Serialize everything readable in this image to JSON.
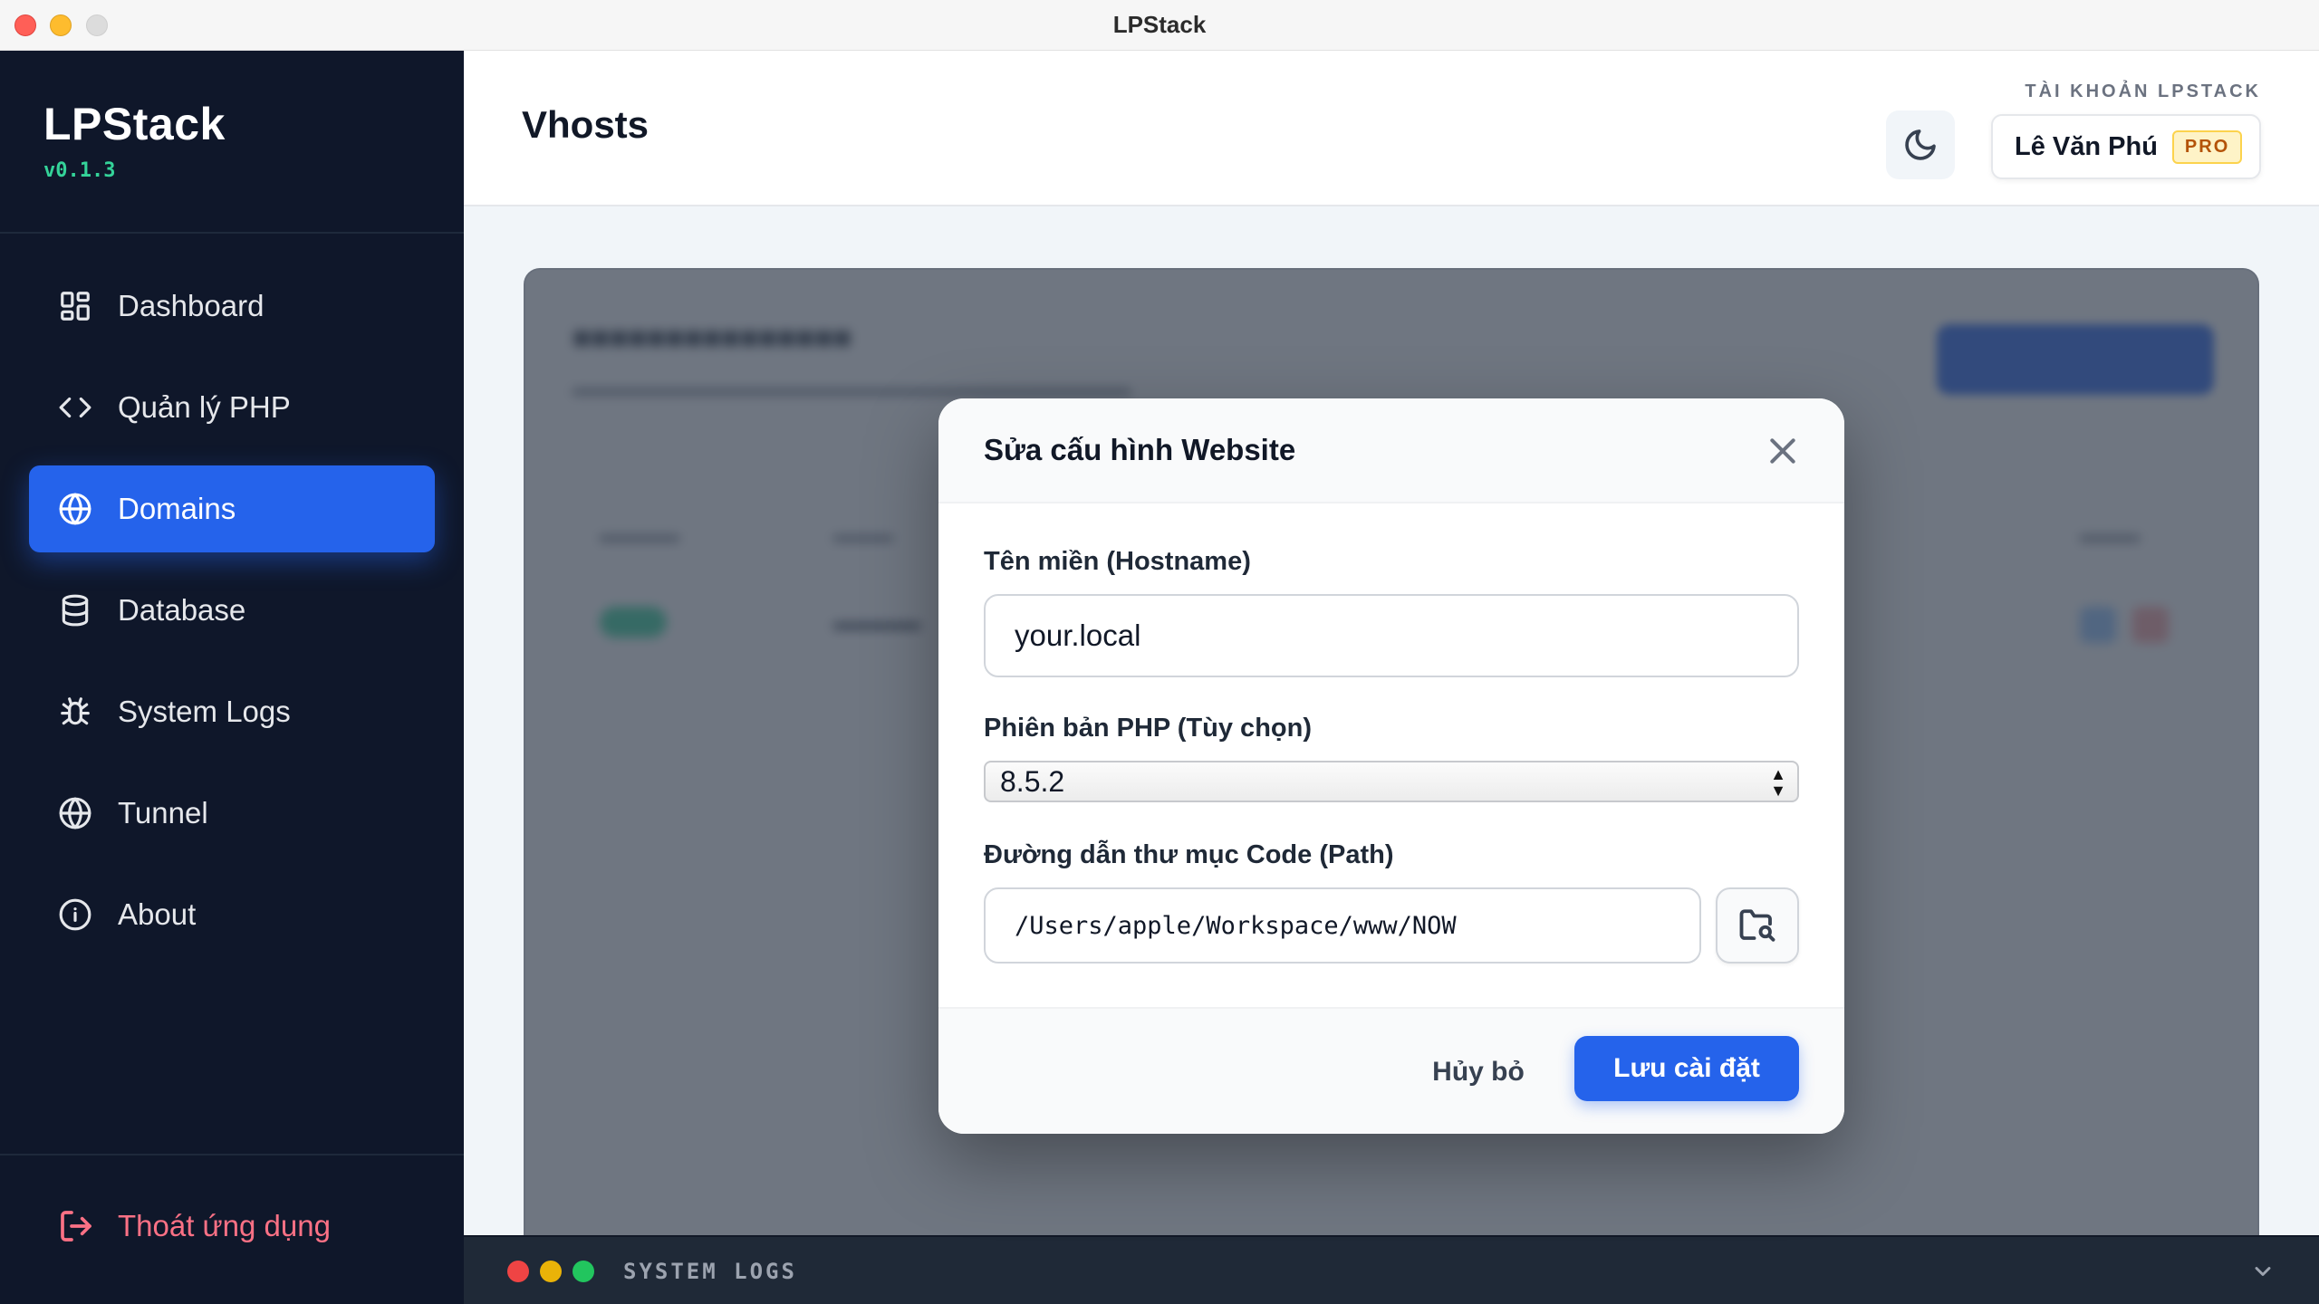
{
  "window": {
    "title": "LPStack"
  },
  "sidebar": {
    "brand": "LPStack",
    "version": "v0.1.3",
    "items": [
      {
        "label": "Dashboard",
        "icon": "dashboard-grid-icon"
      },
      {
        "label": "Quản lý PHP",
        "icon": "code-icon"
      },
      {
        "label": "Domains",
        "icon": "globe-icon",
        "active": true
      },
      {
        "label": "Database",
        "icon": "database-icon"
      },
      {
        "label": "System Logs",
        "icon": "bug-icon"
      },
      {
        "label": "Tunnel",
        "icon": "globe-icon"
      },
      {
        "label": "About",
        "icon": "info-icon"
      }
    ],
    "logout_label": "Thoát ứng dụng"
  },
  "header": {
    "title": "Vhosts",
    "account_label": "TÀI KHOẢN LPSTACK",
    "account_name": "Lê Văn Phú",
    "badge": "PRO"
  },
  "modal": {
    "title": "Sửa cấu hình Website",
    "hostname_label": "Tên miền (Hostname)",
    "hostname_value": "your.local",
    "php_label": "Phiên bản PHP (Tùy chọn)",
    "php_value": "8.5.2",
    "path_label": "Đường dẫn thư mục Code (Path)",
    "path_value": "/Users/apple/Workspace/www/NOW",
    "cancel_label": "Hủy bỏ",
    "save_label": "Lưu cài đặt"
  },
  "logs": {
    "title": "SYSTEM LOGS"
  },
  "colors": {
    "accent": "#2563eb",
    "sidebar_bg": "#0f172a",
    "version_green": "#34d399",
    "logout_red": "#fb7185"
  }
}
